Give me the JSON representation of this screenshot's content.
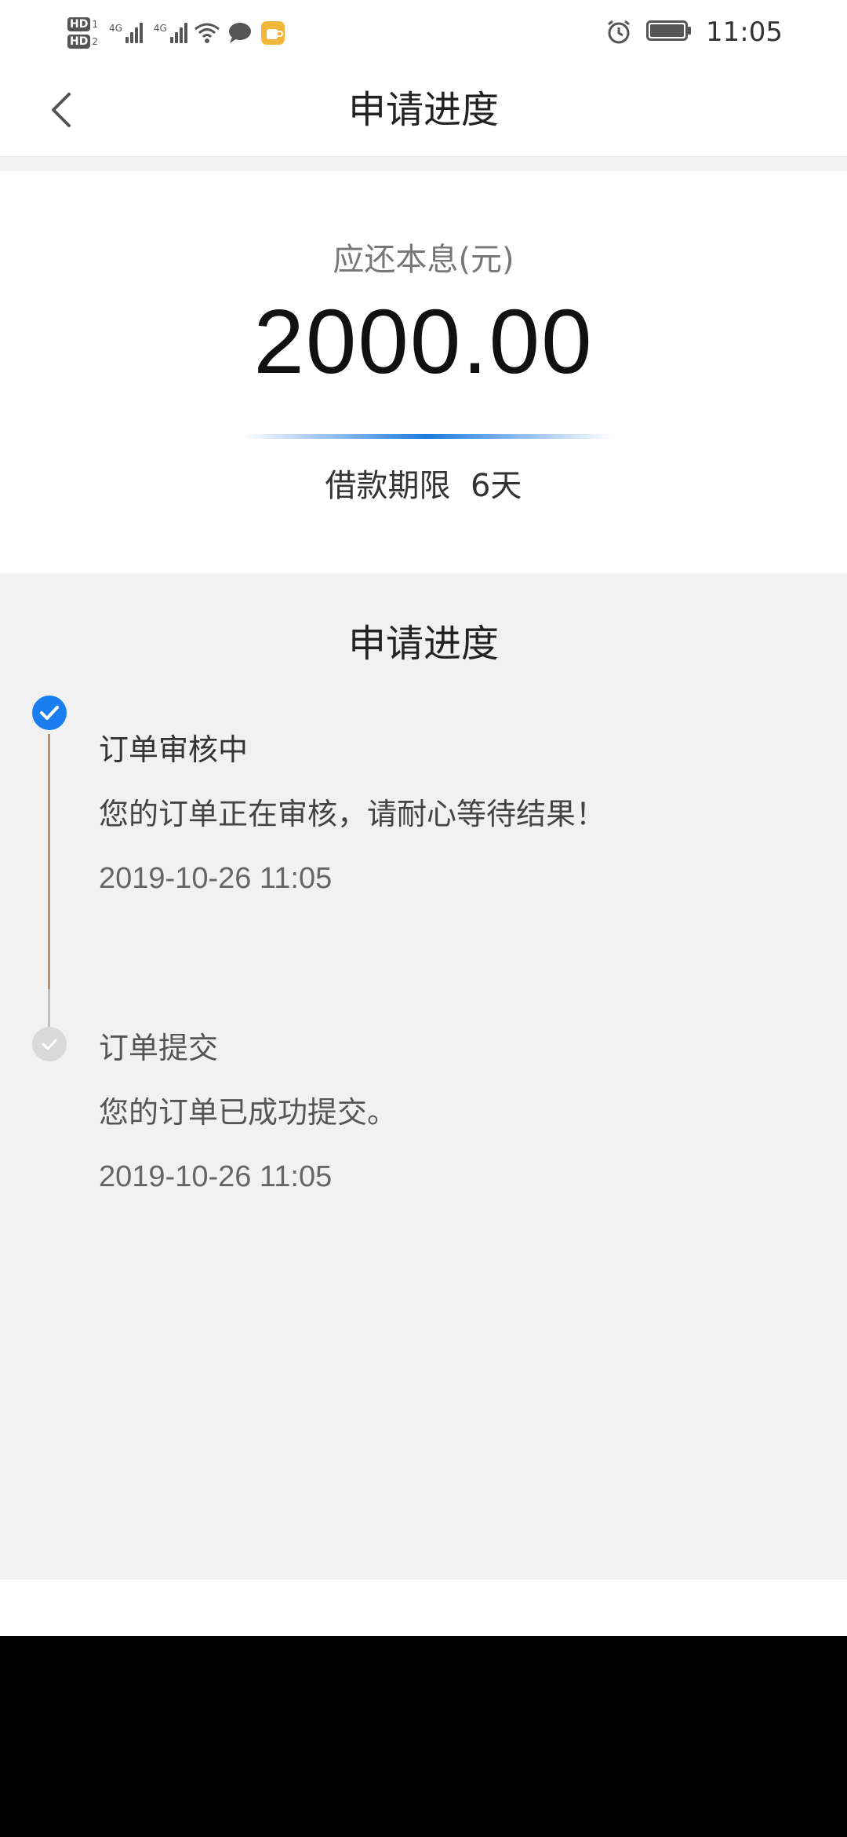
{
  "status_bar": {
    "hd1_label": "HD",
    "hd1_num": "1",
    "hd2_label": "HD",
    "hd2_num": "2",
    "sig1_label": "4G",
    "sig2_label": "4G",
    "icons": [
      "wifi-icon",
      "message-icon",
      "app-notification-icon",
      "alarm-icon",
      "battery-icon"
    ],
    "time": "11:05"
  },
  "header": {
    "title": "申请进度",
    "back_icon": "chevron-left-icon"
  },
  "amount_card": {
    "label": "应还本息(元)",
    "value": "2000.00",
    "loan_term": "借款期限  6天",
    "accent_color": "#1e78dc"
  },
  "progress": {
    "title": "申请进度",
    "steps": [
      {
        "title": "订单审核中",
        "desc": "您的订单正在审核，请耐心等待结果！",
        "time": "2019-10-26 11:05",
        "status": "active"
      },
      {
        "title": "订单提交",
        "desc": "您的订单已成功提交。",
        "time": "2019-10-26 11:05",
        "status": "done"
      }
    ]
  },
  "colors": {
    "active_node": "#1a7ef0",
    "done_node": "#d9d9d9",
    "timeline": "#b89070",
    "section_bg": "#f1f1f1"
  }
}
